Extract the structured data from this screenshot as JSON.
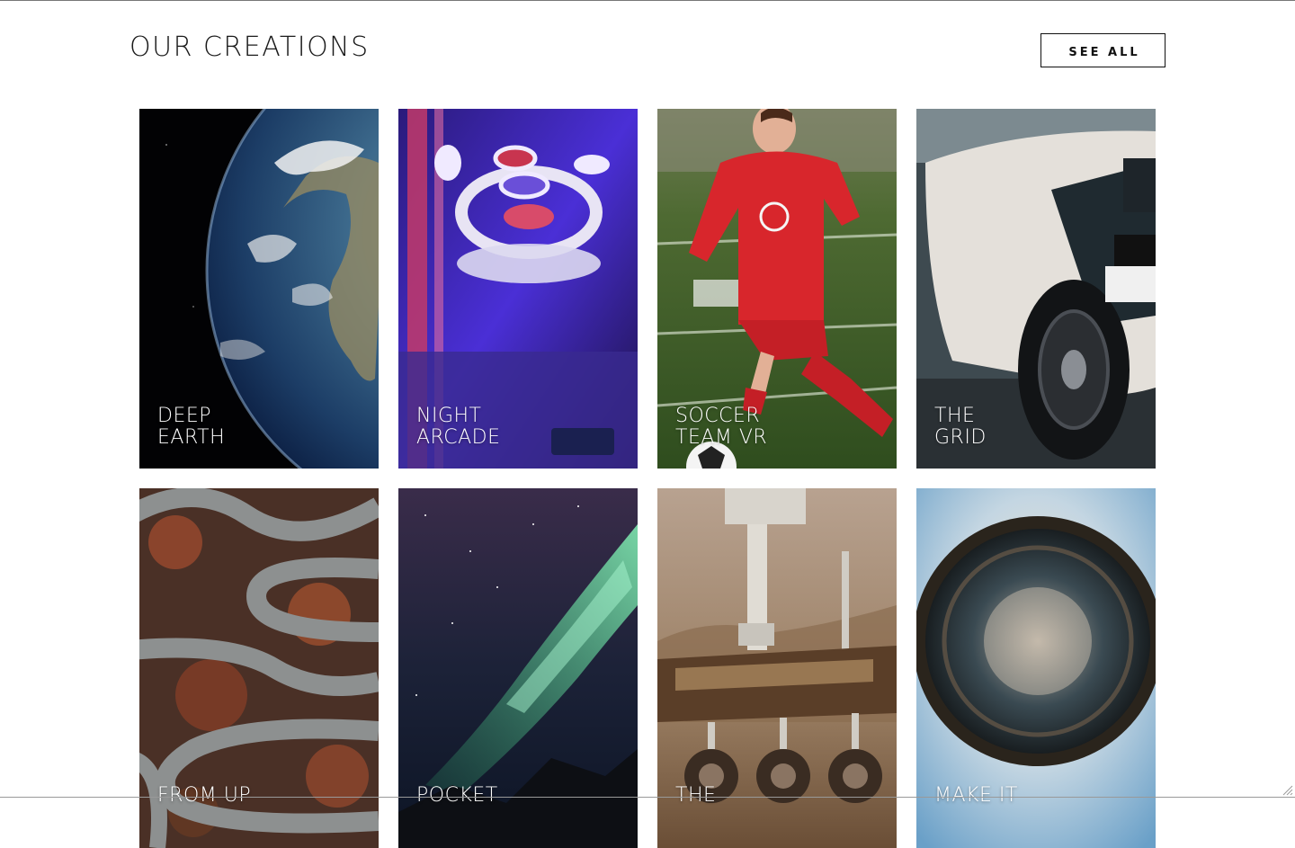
{
  "header": {
    "title": "OUR CREATIONS",
    "see_all_label": "SEE ALL"
  },
  "cards": [
    {
      "line1": "DEEP",
      "line2": "EARTH",
      "image": "earth-from-space"
    },
    {
      "line1": "NIGHT",
      "line2": "ARCADE",
      "image": "skee-ball-arcade"
    },
    {
      "line1": "SOCCER",
      "line2": "TEAM VR",
      "image": "soccer-player"
    },
    {
      "line1": "THE",
      "line2": "GRID",
      "image": "race-car"
    },
    {
      "line1": "FROM UP",
      "line2": "",
      "image": "aerial-winding-road"
    },
    {
      "line1": "POCKET",
      "line2": "",
      "image": "aurora-night-sky"
    },
    {
      "line1": "THE",
      "line2": "",
      "image": "mars-rover"
    },
    {
      "line1": "MAKE IT",
      "line2": "",
      "image": "tiny-planet-panorama"
    }
  ],
  "colors": {
    "text": "#1a1a1a",
    "background": "#ffffff",
    "card_text": "#ffffff"
  }
}
